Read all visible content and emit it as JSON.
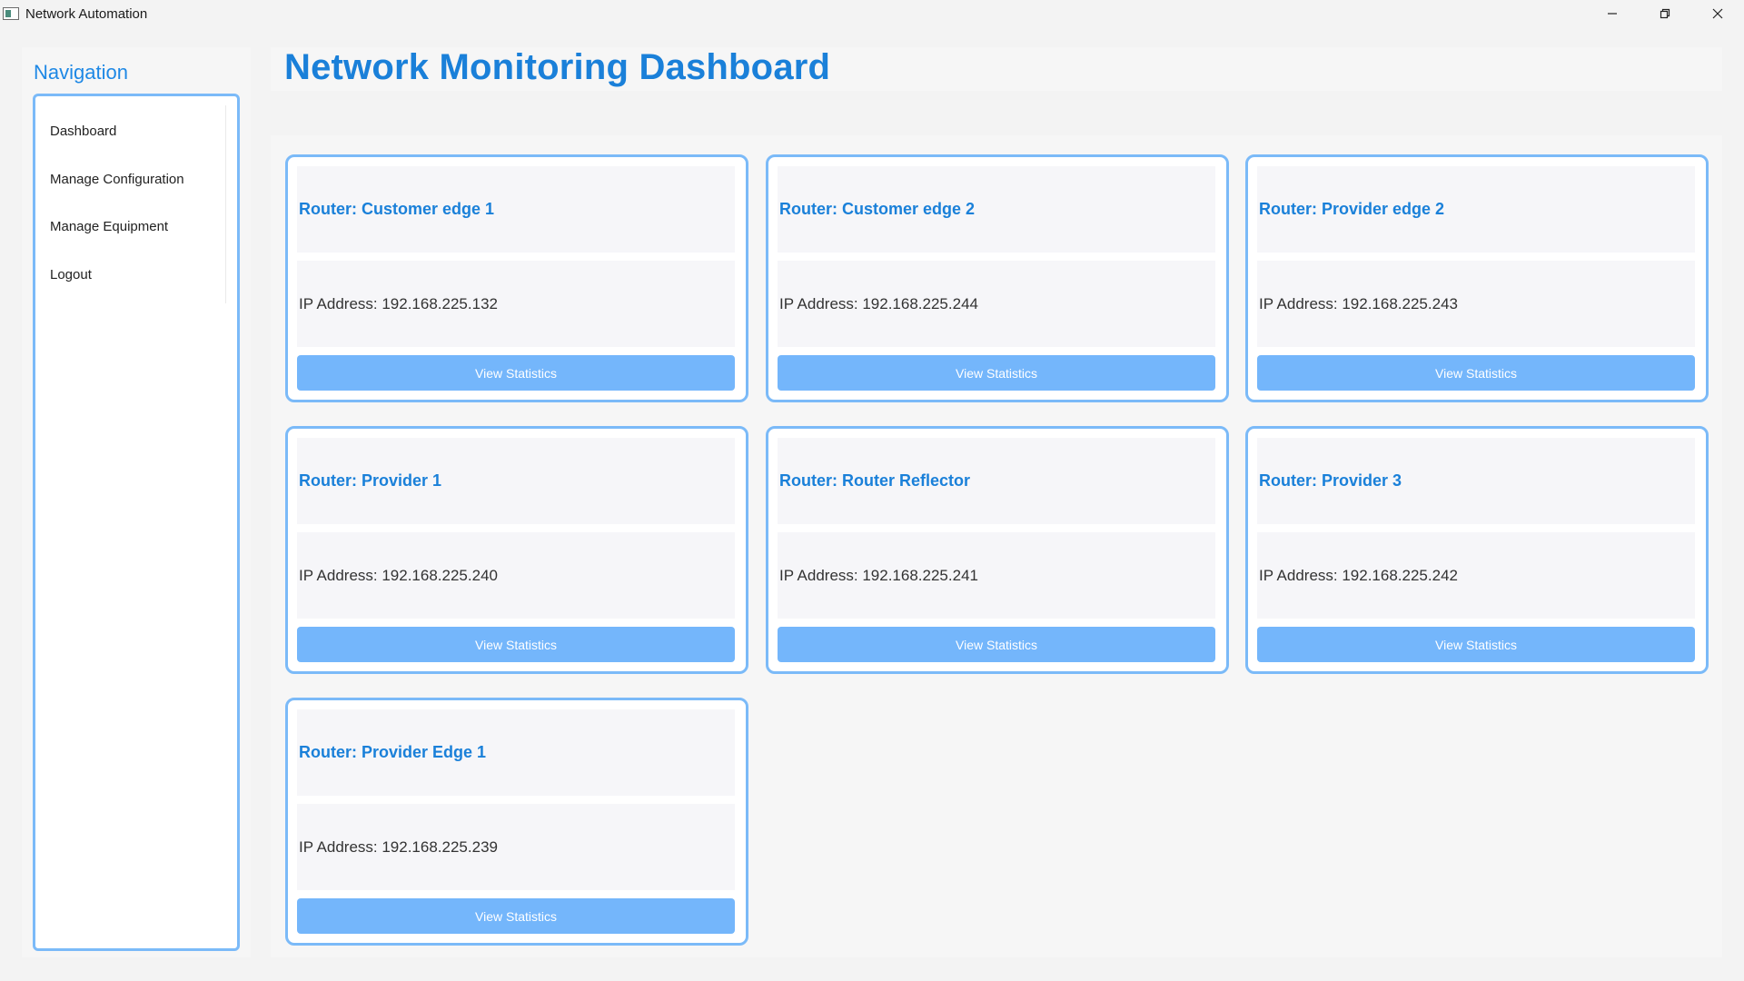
{
  "window": {
    "title": "Network Automation",
    "controls": [
      "minimize",
      "restore",
      "close"
    ]
  },
  "sidebar": {
    "title": "Navigation",
    "items": [
      {
        "label": "Dashboard"
      },
      {
        "label": "Manage Configuration"
      },
      {
        "label": "Manage Equipment"
      },
      {
        "label": "Logout"
      }
    ]
  },
  "header": {
    "title": "Network Monitoring Dashboard"
  },
  "routers": [
    {
      "name": "Router: Customer edge 1",
      "ip": "IP Address: 192.168.225.132",
      "button": "View Statistics"
    },
    {
      "name": "Router: Customer edge 2",
      "ip": "IP Address: 192.168.225.244",
      "button": "View Statistics"
    },
    {
      "name": "Router: Provider edge 2",
      "ip": "IP Address: 192.168.225.243",
      "button": "View Statistics"
    },
    {
      "name": "Router: Provider 1",
      "ip": "IP Address: 192.168.225.240",
      "button": "View Statistics"
    },
    {
      "name": "Router: Router Reflector",
      "ip": "IP Address: 192.168.225.241",
      "button": "View Statistics"
    },
    {
      "name": "Router: Provider 3",
      "ip": "IP Address: 192.168.225.242",
      "button": "View Statistics"
    },
    {
      "name": "Router: Provider Edge 1",
      "ip": "IP Address: 192.168.225.239",
      "button": "View Statistics"
    }
  ],
  "colors": {
    "accent": "#1a80d9",
    "card_border": "#7bbaf8",
    "button": "#74b6fb"
  }
}
